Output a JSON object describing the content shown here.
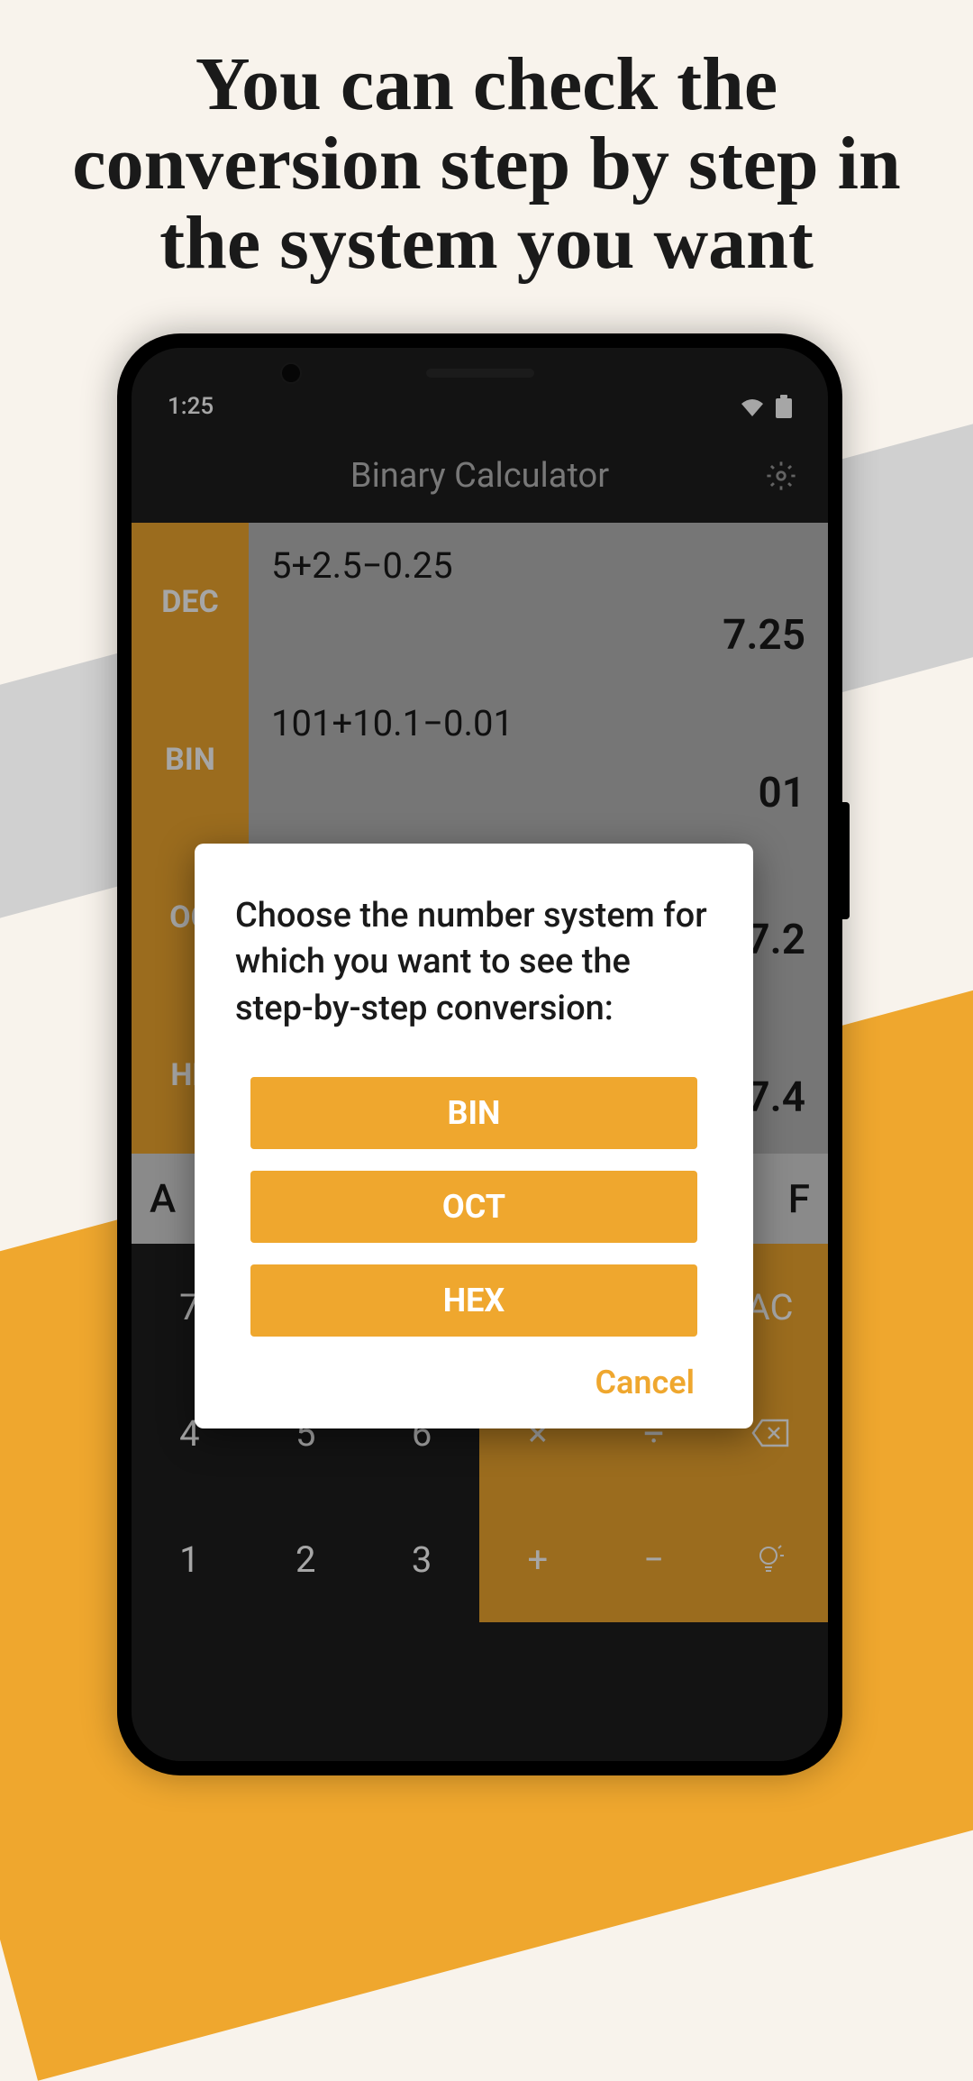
{
  "headline": "You can check the conversion step by step in the system you want",
  "status": {
    "time": "1:25"
  },
  "header": {
    "title": "Binary Calculator"
  },
  "rows": [
    {
      "label": "DEC",
      "expr": "5+2.5−0.25",
      "result": "7.25"
    },
    {
      "label": "BIN",
      "expr": "101+10.1−0.01",
      "result": "01"
    },
    {
      "label": "OC",
      "expr": "",
      "result": "7.2"
    },
    {
      "label": "HE",
      "expr": "",
      "result": "7.4"
    }
  ],
  "hex_keys": [
    "A",
    "F"
  ],
  "keypad": {
    "row1": [
      "7",
      "",
      "",
      "",
      "",
      "AC"
    ],
    "row2": [
      "4",
      "5",
      "6",
      "×",
      "÷",
      ""
    ],
    "row3": [
      "1",
      "2",
      "3",
      "+",
      "−",
      ""
    ]
  },
  "dialog": {
    "title": "Choose the number system for which you want to see the step-by-step conversion:",
    "options": [
      "BIN",
      "OCT",
      "HEX"
    ],
    "cancel": "Cancel"
  },
  "colors": {
    "accent": "#efa72e",
    "bg": "#f8f3ec"
  }
}
